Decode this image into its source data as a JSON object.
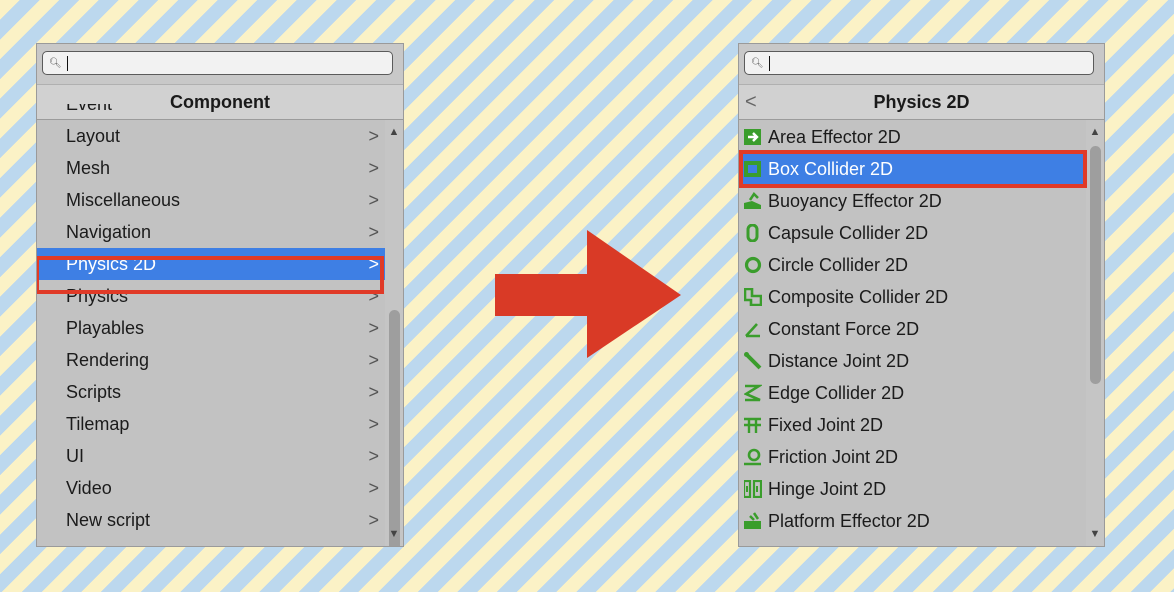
{
  "left_panel": {
    "title": "Component",
    "items": [
      {
        "label": "Event"
      },
      {
        "label": "Layout"
      },
      {
        "label": "Mesh"
      },
      {
        "label": "Miscellaneous"
      },
      {
        "label": "Navigation"
      },
      {
        "label": "Physics 2D"
      },
      {
        "label": "Physics"
      },
      {
        "label": "Playables"
      },
      {
        "label": "Rendering"
      },
      {
        "label": "Scripts"
      },
      {
        "label": "Tilemap"
      },
      {
        "label": "UI"
      },
      {
        "label": "Video"
      },
      {
        "label": "New script"
      }
    ],
    "selected": "Physics 2D",
    "chevron": ">"
  },
  "right_panel": {
    "title": "Physics 2D",
    "back": "<",
    "items": [
      {
        "label": "Area Effector 2D",
        "icon": "area-effector-icon"
      },
      {
        "label": "Box Collider 2D",
        "icon": "box-collider-icon"
      },
      {
        "label": "Buoyancy Effector 2D",
        "icon": "buoyancy-effector-icon"
      },
      {
        "label": "Capsule Collider 2D",
        "icon": "capsule-collider-icon"
      },
      {
        "label": "Circle Collider 2D",
        "icon": "circle-collider-icon"
      },
      {
        "label": "Composite Collider 2D",
        "icon": "composite-collider-icon"
      },
      {
        "label": "Constant Force 2D",
        "icon": "constant-force-icon"
      },
      {
        "label": "Distance Joint 2D",
        "icon": "distance-joint-icon"
      },
      {
        "label": "Edge Collider 2D",
        "icon": "edge-collider-icon"
      },
      {
        "label": "Fixed Joint 2D",
        "icon": "fixed-joint-icon"
      },
      {
        "label": "Friction Joint 2D",
        "icon": "friction-joint-icon"
      },
      {
        "label": "Hinge Joint 2D",
        "icon": "hinge-joint-icon"
      },
      {
        "label": "Platform Effector 2D",
        "icon": "platform-effector-icon"
      }
    ],
    "selected": "Box Collider 2D"
  },
  "colors": {
    "selection": "#3e7fe4",
    "highlight": "#e03a27",
    "icon_green": "#3a9d2c",
    "arrow": "#d93a26"
  }
}
